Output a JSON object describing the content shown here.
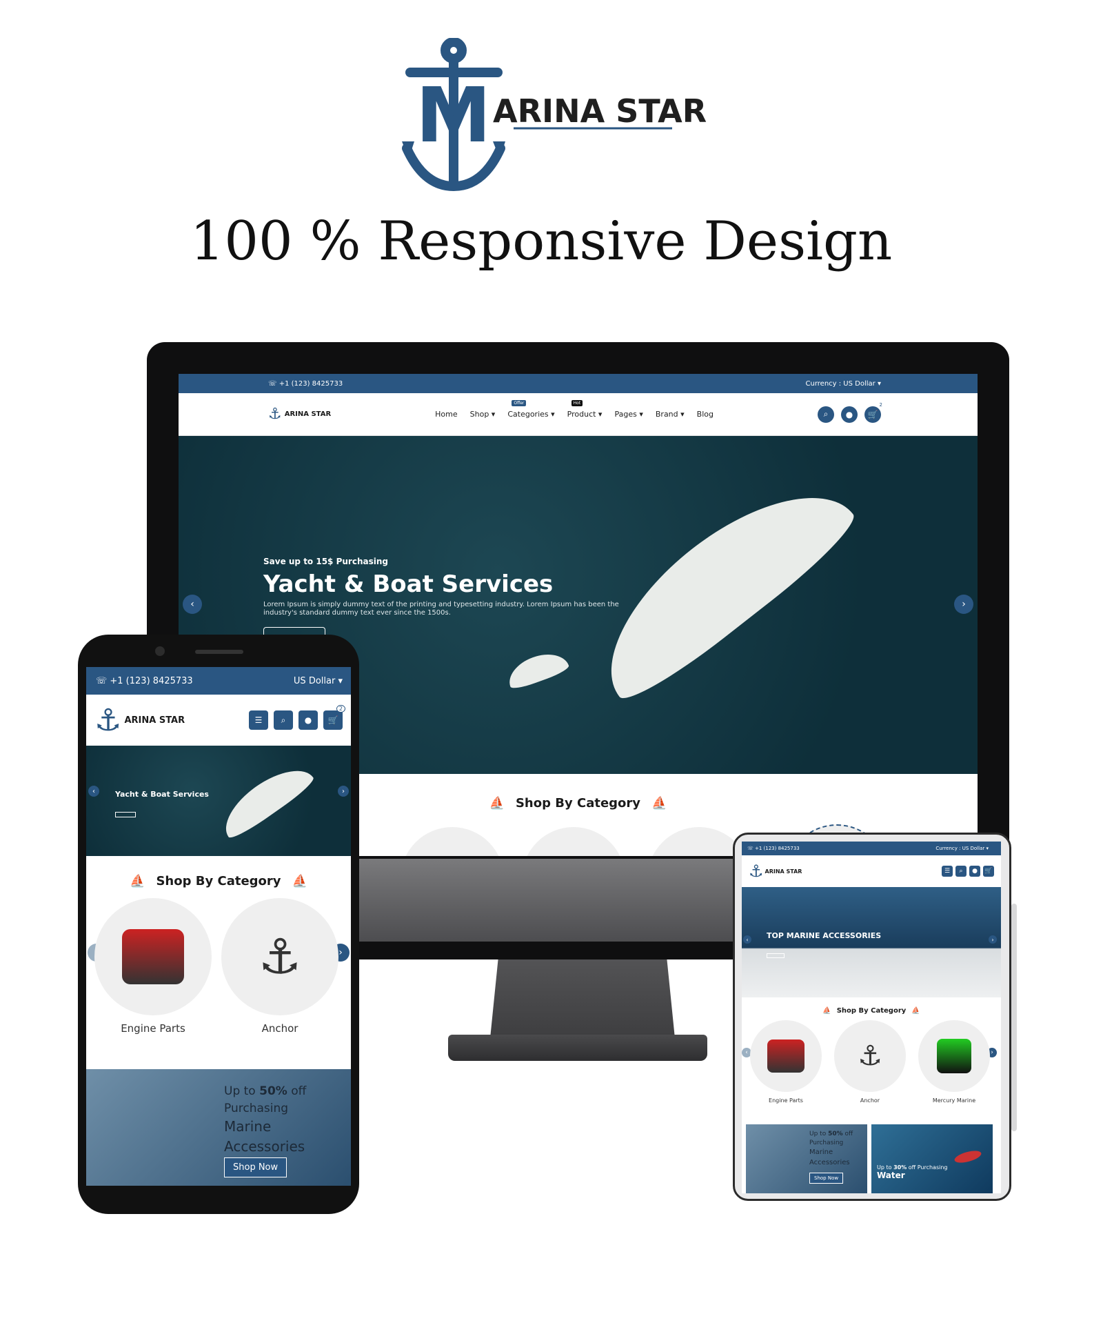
{
  "brand": {
    "name": "ARINA STAR",
    "initial": "M"
  },
  "headline": "100 % Responsive Design",
  "desktop": {
    "phone": "+1 (123) 8425733",
    "currency": "Currency : US Dollar",
    "nav": [
      "Home",
      "Shop",
      "Categories",
      "Product",
      "Pages",
      "Brand",
      "Blog"
    ],
    "nav_tags": {
      "offer": "Offer",
      "hot": "Hot"
    },
    "cart_count": "2",
    "hero": {
      "kicker": "Save up to 15$ Purchasing",
      "title": "Yacht & Boat Services",
      "body": "Lorem Ipsum is simply dummy text of the printing and typesetting industry. Lorem Ipsum has been the industry's standard dummy text ever since the 1500s."
    },
    "section_title": "Shop By Category"
  },
  "phone": {
    "phone": "+1 (123) 8425733",
    "currency": "US Dollar",
    "cart_count": "2",
    "hero_title": "Yacht & Boat Services",
    "section_title": "Shop By Category",
    "categories": [
      "Engine Parts",
      "Anchor"
    ],
    "banner": {
      "line1a": "Up to ",
      "line1b": "50%",
      "line1c": " off",
      "line2": "Purchasing",
      "line3": "Marine",
      "line4": "Accessories",
      "button": "Shop Now"
    }
  },
  "tablet": {
    "phone": "+1 (123) 8425733",
    "currency": "Currency : US Dollar",
    "hero_title": "TOP MARINE ACCESSORIES",
    "section_title": "Shop By Category",
    "categories": [
      "Engine Parts",
      "Anchor",
      "Mercury Marine"
    ],
    "banner1": {
      "line1a": "Up to ",
      "line1b": "50%",
      "line1c": " off",
      "line2": "Purchasing",
      "line3": "Marine",
      "line4": "Accessories",
      "button": "Shop Now"
    },
    "banner2": {
      "line1a": "Up to ",
      "line1b": "30%",
      "line1c": " off Purchasing",
      "line2": "Water"
    }
  },
  "colors": {
    "brand": "#2a5682",
    "dark_sea": "#0e2f3a"
  },
  "icons": [
    "anchor-logo-icon",
    "phone-icon",
    "chevron-down-icon",
    "search-icon",
    "user-icon",
    "cart-icon",
    "menu-icon",
    "arrow-left-icon",
    "arrow-right-icon",
    "sailboat-icon"
  ]
}
